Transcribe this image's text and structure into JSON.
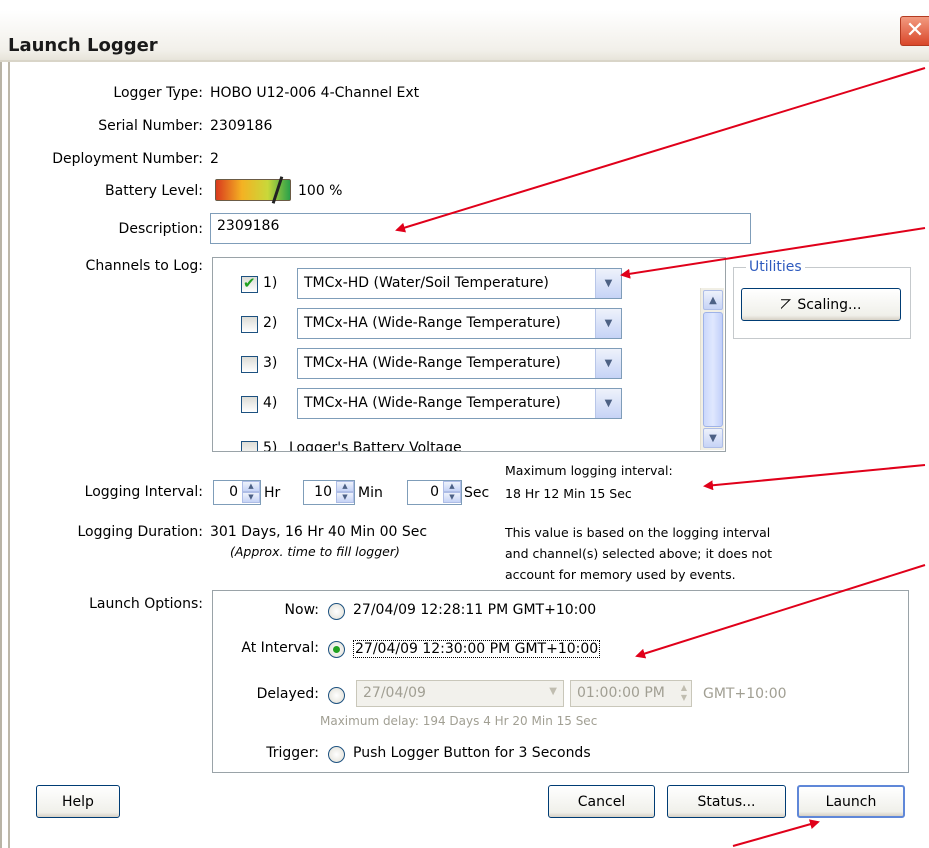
{
  "window": {
    "title": "Launch Logger"
  },
  "info": {
    "logger_type_label": "Logger Type:",
    "logger_type_value": "HOBO U12-006 4-Channel Ext",
    "serial_label": "Serial Number:",
    "serial_value": "2309186",
    "deployment_label": "Deployment Number:",
    "deployment_value": "2",
    "battery_label": "Battery Level:",
    "battery_value": "100 %",
    "battery_level": 1.0,
    "description_label": "Description:",
    "description_value": "2309186"
  },
  "channels": {
    "label": "Channels to Log:",
    "items": [
      {
        "num": "1)",
        "checked": true,
        "sensor": "TMCx-HD (Water/Soil Temperature)"
      },
      {
        "num": "2)",
        "checked": false,
        "sensor": "TMCx-HA (Wide-Range Temperature)"
      },
      {
        "num": "3)",
        "checked": false,
        "sensor": "TMCx-HA (Wide-Range Temperature)"
      },
      {
        "num": "4)",
        "checked": false,
        "sensor": "TMCx-HA (Wide-Range Temperature)"
      },
      {
        "num": "5)",
        "checked": false,
        "sensor": "Logger's Battery Voltage"
      }
    ]
  },
  "utilities": {
    "title": "Utilities",
    "scaling_button": "Scaling..."
  },
  "interval": {
    "label": "Logging Interval:",
    "hr_value": "0",
    "hr_unit": "Hr",
    "min_value": "10",
    "min_unit": "Min",
    "sec_value": "0",
    "sec_unit": "Sec",
    "max_label": "Maximum logging interval:",
    "max_value": "18 Hr 12 Min 15 Sec"
  },
  "duration": {
    "label": "Logging Duration:",
    "value": "301 Days, 16 Hr 40 Min 00 Sec",
    "hint": "(Approx. time to fill logger)",
    "note_line1": "This value is based on the logging interval",
    "note_line2": "and channel(s) selected above; it does not",
    "note_line3": "account for memory used by events."
  },
  "launch": {
    "label": "Launch Options:",
    "now_label": "Now:",
    "now_value": "27/04/09 12:28:11 PM GMT+10:00",
    "interval_label": "At Interval:",
    "interval_value": "27/04/09 12:30:00 PM GMT+10:00",
    "delayed_label": "Delayed:",
    "delayed_date": "27/04/09",
    "delayed_time": "01:00:00 PM",
    "delayed_tz": "GMT+10:00",
    "max_delay": "Maximum delay: 194 Days  4 Hr 20 Min 15 Sec",
    "trigger_label": "Trigger:",
    "trigger_value": "Push Logger Button for 3 Seconds",
    "selected": "At Interval"
  },
  "buttons": {
    "help": "Help",
    "cancel": "Cancel",
    "status": "Status...",
    "launch": "Launch"
  },
  "colors": {
    "annotation_arrow": "#e0001a",
    "accent_green": "#21a121",
    "close_red": "#d9472a"
  }
}
